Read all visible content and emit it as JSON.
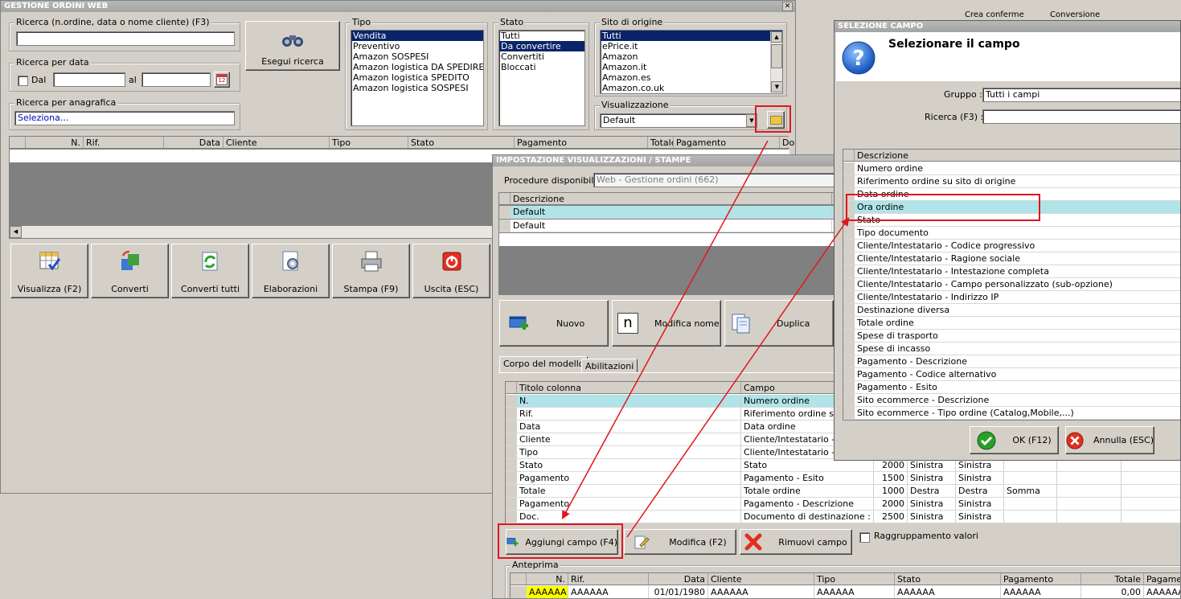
{
  "main": {
    "title": "GESTIONE ORDINI WEB",
    "search_group": "Ricerca (n.ordine, data o nome cliente) (F3)",
    "search_value": "",
    "date_group": "Ricerca per data",
    "date_from_label": "Dal",
    "date_to_label": "al",
    "date_from_value": "",
    "date_to_value": "",
    "anagrafica_group": "Ricerca per anagrafica",
    "anagrafica_value": "Seleziona...",
    "search_button": "Esegui ricerca",
    "tipo_group": "Tipo",
    "tipo_items": [
      "Vendita",
      "Preventivo",
      "Amazon SOSPESI",
      "Amazon logistica DA SPEDIRE",
      "Amazon logistica SPEDITO",
      "Amazon logistica SOSPESI"
    ],
    "stato_group": "Stato",
    "stato_items": [
      "Tutti",
      "Da convertire",
      "Convertiti",
      "Bloccati"
    ],
    "sito_group": "Sito di origine",
    "sito_items": [
      "Tutti",
      "ePrice.it",
      "Amazon",
      "Amazon.it",
      "Amazon.es",
      "Amazon.co.uk"
    ],
    "visual_group": "Visualizzazione",
    "visual_value": "Default",
    "grid_headers": [
      "N.",
      "Rif.",
      "Data",
      "Cliente",
      "Tipo",
      "Stato",
      "Pagamento",
      "Totale",
      "Pagamento",
      "Doc."
    ],
    "buttons": [
      "Visualizza (F2)",
      "Converti",
      "Converti tutti",
      "Elaborazioni",
      "Stampa (F9)",
      "Uscita (ESC)"
    ],
    "top_right_labels": [
      "Crea conferme",
      "Conversione"
    ]
  },
  "impost": {
    "title": "IMPOSTAZIONE VISUALIZZAZIONI / STAMPE",
    "proc_label": "Procedure disponibili :",
    "proc_value": "Web - Gestione ordini (662)",
    "desc_header": "Descrizione",
    "desc_rows": [
      "Default",
      "Default"
    ],
    "buttons": [
      "Nuovo",
      "Modifica nome",
      "Duplica"
    ],
    "tabs": [
      "Corpo del modello",
      "Abilitazioni"
    ],
    "col_headers": [
      "Titolo colonna",
      "Campo"
    ],
    "rows": [
      {
        "titolo": "N.",
        "campo": "Numero ordine",
        "w": "",
        "a1": "",
        "a2": "",
        "t": ""
      },
      {
        "titolo": "Rif.",
        "campo": "Riferimento ordine su sito di origine",
        "w": "",
        "a1": "",
        "a2": "",
        "t": ""
      },
      {
        "titolo": "Data",
        "campo": "Data ordine",
        "w": "",
        "a1": "",
        "a2": "",
        "t": ""
      },
      {
        "titolo": "Cliente",
        "campo": "Cliente/Intestatario - Ragione sociale",
        "w": "",
        "a1": "",
        "a2": "",
        "t": ""
      },
      {
        "titolo": "Tipo",
        "campo": "Cliente/Intestatario - Campo personalizzato",
        "w": "",
        "a1": "",
        "a2": "",
        "t": ""
      },
      {
        "titolo": "Stato",
        "campo": "Stato",
        "w": "2000",
        "a1": "Sinistra",
        "a2": "Sinistra",
        "t": ""
      },
      {
        "titolo": "Pagamento",
        "campo": "Pagamento - Esito",
        "w": "1500",
        "a1": "Sinistra",
        "a2": "Sinistra",
        "t": ""
      },
      {
        "titolo": "Totale",
        "campo": "Totale ordine",
        "w": "1000",
        "a1": "Destra",
        "a2": "Destra",
        "t": "Somma"
      },
      {
        "titolo": "Pagamento",
        "campo": "Pagamento - Descrizione",
        "w": "2000",
        "a1": "Sinistra",
        "a2": "Sinistra",
        "t": ""
      },
      {
        "titolo": "Doc.",
        "campo": "Documento di destinazione : Ti...",
        "w": "2500",
        "a1": "Sinistra",
        "a2": "Sinistra",
        "t": ""
      }
    ],
    "add_button": "Aggiungi campo (F4)",
    "edit_button": "Modifica (F2)",
    "remove_button": "Rimuovi campo",
    "group_check": "Raggruppamento valori",
    "preview_group": "Anteprima",
    "preview_headers": [
      "N.",
      "Rif.",
      "Data",
      "Cliente",
      "Tipo",
      "Stato",
      "Pagamento",
      "Totale",
      "Pagamento"
    ],
    "preview_row": [
      "AAAAAA",
      "AAAAAA",
      "01/01/1980",
      "AAAAAA",
      "AAAAAA",
      "AAAAAA",
      "AAAAAA",
      "0,00",
      "AAAAAA"
    ]
  },
  "selez": {
    "title": "SELEZIONE CAMPO",
    "heading": "Selezionare il campo",
    "gruppo_label": "Gruppo :",
    "gruppo_value": "Tutti i campi",
    "ricerca_label": "Ricerca (F3) :",
    "ricerca_value": "",
    "list_header": "Descrizione",
    "items": [
      "Numero ordine",
      "Riferimento ordine su sito di origine",
      "Data ordine",
      "Ora ordine",
      "Stato",
      "Tipo documento",
      "Cliente/Intestatario - Codice progressivo",
      "Cliente/Intestatario - Ragione sociale",
      "Cliente/Intestatario - Intestazione completa",
      "Cliente/Intestatario - Campo personalizzato (sub-opzione)",
      "Cliente/Intestatario - Indirizzo IP",
      "Destinazione diversa",
      "Totale ordine",
      "Spese di trasporto",
      "Spese di incasso",
      "Pagamento - Descrizione",
      "Pagamento - Codice alternativo",
      "Pagamento - Esito",
      "Sito ecommerce - Descrizione",
      "Sito ecommerce - Tipo ordine (Catalog,Mobile,...)"
    ],
    "ok_button": "OK (F12)",
    "cancel_button": "Annulla (ESC)"
  },
  "colors": {
    "selection": "#0a246a",
    "row_highlight": "#b0e4e8",
    "annotation": "#e0161e",
    "grey_area": "#808080",
    "preview_yellow": "#ffff00"
  }
}
